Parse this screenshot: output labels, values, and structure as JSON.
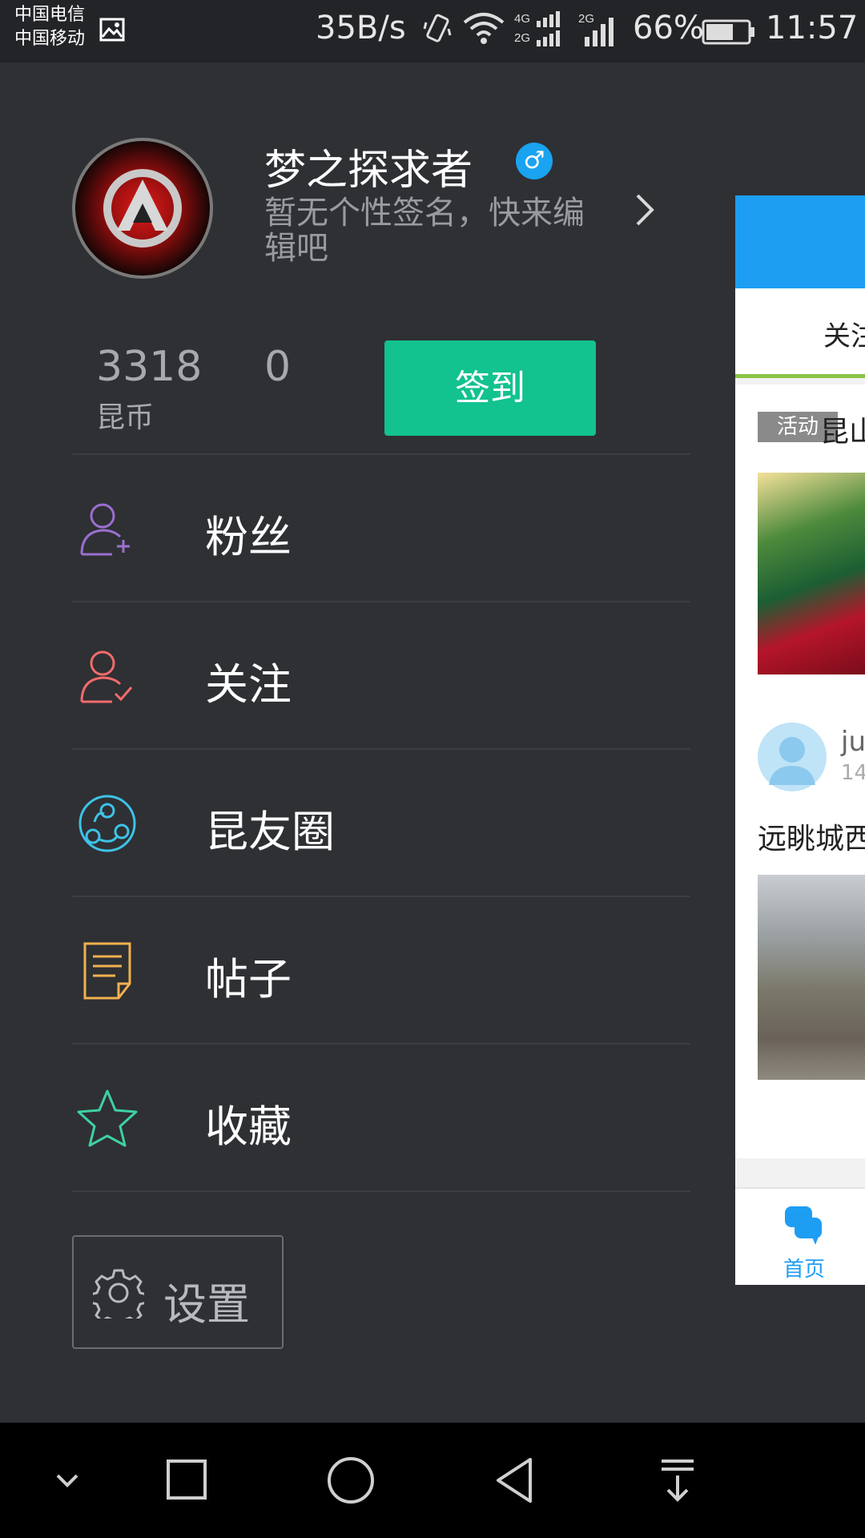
{
  "status_bar": {
    "carrier_1": "中国电信",
    "carrier_2": "中国移动",
    "net_speed": "35B/s",
    "signal_1_label_top": "4G",
    "signal_1_label_bottom": "2G",
    "signal_2_label": "2G",
    "battery_percent": "66%",
    "battery_level": 0.66,
    "time": "11:57"
  },
  "profile": {
    "username": "梦之探求者",
    "gender_symbol": "♂",
    "signature": "暂无个性签名，快来编辑吧",
    "coins": "3318",
    "coins_label": "昆币",
    "second_stat": "0",
    "checkin_label": "签到"
  },
  "menu": {
    "items": [
      {
        "label": "粉丝",
        "icon": "fans-icon",
        "color": "#9b6fd0"
      },
      {
        "label": "关注",
        "icon": "follow-icon",
        "color": "#f26b6b"
      },
      {
        "label": "昆友圈",
        "icon": "circle-icon",
        "color": "#3ec3e6"
      },
      {
        "label": "帖子",
        "icon": "post-icon",
        "color": "#f2b14f"
      },
      {
        "label": "收藏",
        "icon": "star-icon",
        "color": "#3ed1a2"
      }
    ]
  },
  "settings": {
    "label": "设置"
  },
  "peek": {
    "tab_text": "关注",
    "tag": "活动",
    "title_1": "昆山",
    "user": "ju",
    "time": "14",
    "title_2": "远眺城西",
    "home_label": "首页"
  },
  "colors": {
    "background": "#2e3034",
    "checkin": "#12c28f",
    "accent_blue": "#1e9ef2"
  }
}
